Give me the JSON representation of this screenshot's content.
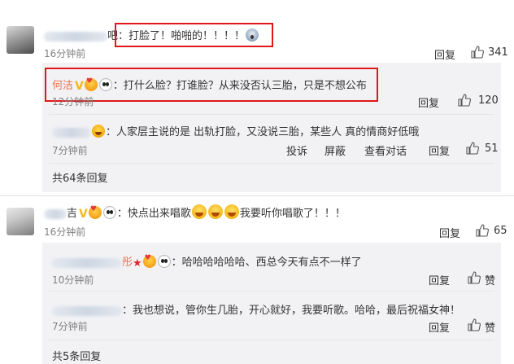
{
  "comments": [
    {
      "author_suffix": "吧",
      "text": "：打脸了！啪啪的！！！！",
      "time": "16分钟前",
      "reply": "回复",
      "likes": "341"
    },
    {
      "author_suffix": "吉",
      "text": "：快点出来唱歌",
      "text2": "我要听你唱歌了！！！",
      "time": "16分钟前",
      "reply": "回复",
      "likes": "65"
    }
  ],
  "replies_1": [
    {
      "author": "何洁",
      "text": "：打什么脸？打谁脸？从来没否认三胎，只是不想公布",
      "time": "12分钟前",
      "reply": "回复",
      "likes": "120"
    },
    {
      "text": "：人家层主说的是 出轨打脸，又没说三胎，某些人 真的情商好低哦",
      "time": "7分钟前",
      "report": "投诉",
      "block": "屏蔽",
      "view_conversation": "查看对话",
      "reply": "回复",
      "likes": "51"
    }
  ],
  "replies_1_total": "共64条回复",
  "replies_2": [
    {
      "author_suffix": "彤",
      "text": "：哈哈哈哈哈哈、西总今天有点不一样了",
      "time": "10分钟前",
      "reply": "回复",
      "likes": "赞"
    },
    {
      "text": "：我也想说，管你生几胎，开心就好，我要听歌。哈哈，最后祝福女神！",
      "time": "7分钟前",
      "reply": "回复",
      "likes": "赞"
    }
  ],
  "replies_2_total": "共5条回复",
  "icons": {
    "thumb": "thumbs-up-icon",
    "vip": "v-badge-icon",
    "panda": "panda-emoji-icon"
  },
  "colors": {
    "name_orange": "#eb7350",
    "highlight_red": "#e0181b",
    "reply_bg": "#f2f2f5"
  }
}
